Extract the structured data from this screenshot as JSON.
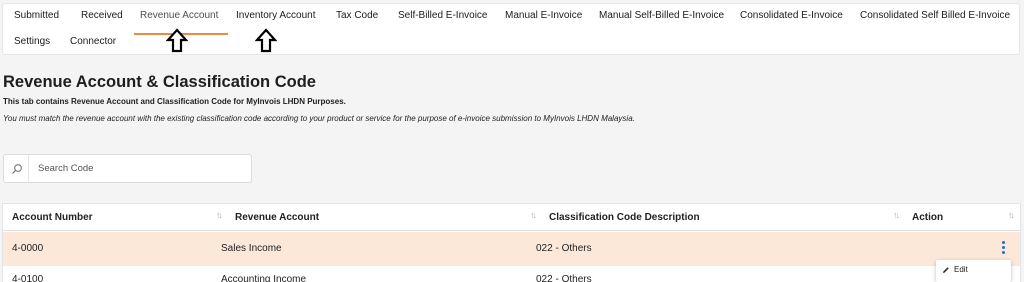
{
  "tabs": [
    {
      "label": "Submitted",
      "active": false
    },
    {
      "label": "Received",
      "active": false
    },
    {
      "label": "Revenue Account",
      "active": true
    },
    {
      "label": "Inventory Account",
      "active": false
    },
    {
      "label": "Tax Code",
      "active": false
    },
    {
      "label": "Self-Billed E-Invoice",
      "active": false
    },
    {
      "label": "Manual E-Invoice",
      "active": false
    },
    {
      "label": "Manual Self-Billed E-Invoice",
      "active": false
    },
    {
      "label": "Consolidated E-Invoice",
      "active": false
    },
    {
      "label": "Consolidated Self Billed E-Invoice",
      "active": false
    },
    {
      "label": "Settings",
      "active": false
    },
    {
      "label": "Connector",
      "active": false
    }
  ],
  "page": {
    "title": "Revenue Account & Classification Code",
    "subtitle": "This tab contains Revenue Account and Classification Code for MyInvois LHDN Purposes.",
    "note": "You must match the revenue account with the existing classification code according to your product or service for the purpose of e-invoice submission to MyInvois LHDN Malaysia."
  },
  "search": {
    "placeholder": "Search Code",
    "value": ""
  },
  "table": {
    "columns": [
      "Account Number",
      "Revenue Account",
      "Classification Code Description",
      "Action"
    ],
    "rows": [
      {
        "account_number": "4-0000",
        "revenue_account": "Sales Income",
        "classification": "022 - Others"
      },
      {
        "account_number": "4-0100",
        "revenue_account": "Accounting Income",
        "classification": "022 - Others"
      }
    ]
  },
  "action_menu": {
    "edit_label": "Edit"
  },
  "colors": {
    "accent": "#e98a45",
    "row_highlight": "#fbe8d9",
    "kebab": "#1f6fd1",
    "background": "#f4f4f4"
  }
}
